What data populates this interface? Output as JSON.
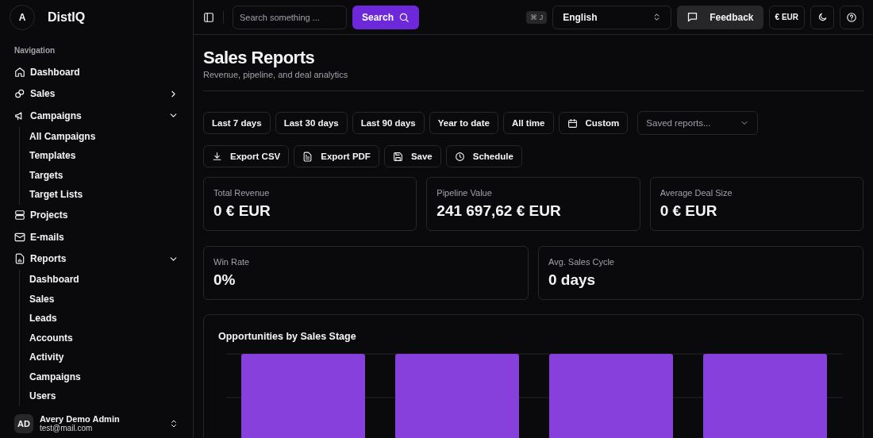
{
  "brand": {
    "avatar": "A",
    "name": "DistIQ"
  },
  "sidebar": {
    "section": "Navigation",
    "items": [
      {
        "label": "Dashboard",
        "kind": "link"
      },
      {
        "label": "Sales",
        "kind": "group",
        "expanded": false
      },
      {
        "label": "Campaigns",
        "kind": "group",
        "expanded": true,
        "children": [
          {
            "label": "All Campaigns"
          },
          {
            "label": "Templates"
          },
          {
            "label": "Targets"
          },
          {
            "label": "Target Lists"
          }
        ]
      },
      {
        "label": "Projects",
        "kind": "link"
      },
      {
        "label": "E-mails",
        "kind": "link"
      },
      {
        "label": "Reports",
        "kind": "group",
        "expanded": true,
        "children": [
          {
            "label": "Dashboard"
          },
          {
            "label": "Sales"
          },
          {
            "label": "Leads"
          },
          {
            "label": "Accounts"
          },
          {
            "label": "Activity"
          },
          {
            "label": "Campaigns"
          },
          {
            "label": "Users"
          }
        ]
      }
    ]
  },
  "user": {
    "initials": "AD",
    "name": "Avery Demo Admin",
    "email": "test@mail.com"
  },
  "topbar": {
    "search_placeholder": "Search something ...",
    "search_button": "Search",
    "shortcut": "⌘ J",
    "language": "English",
    "feedback": "Feedback",
    "currency": "€ EUR"
  },
  "page": {
    "title": "Sales Reports",
    "subtitle": "Revenue, pipeline, and deal analytics"
  },
  "ranges": [
    {
      "label": "Last 7 days"
    },
    {
      "label": "Last 30 days"
    },
    {
      "label": "Last 90 days"
    },
    {
      "label": "Year to date"
    },
    {
      "label": "All time"
    },
    {
      "label": "Custom",
      "kind": "calendar"
    }
  ],
  "saved_reports": {
    "placeholder": "Saved reports..."
  },
  "actions": [
    {
      "label": "Export CSV"
    },
    {
      "label": "Export PDF"
    },
    {
      "label": "Save"
    },
    {
      "label": "Schedule"
    }
  ],
  "metrics_row_1": [
    {
      "label": "Total Revenue",
      "value": "0 € EUR"
    },
    {
      "label": "Pipeline Value",
      "value": "241 697,62 € EUR"
    },
    {
      "label": "Average Deal Size",
      "value": "0 € EUR"
    }
  ],
  "metrics_row_2": [
    {
      "label": "Win Rate",
      "value": "0%"
    },
    {
      "label": "Avg. Sales Cycle",
      "value": "0 days"
    }
  ],
  "chart": {
    "title": "Opportunities by Sales Stage"
  }
}
